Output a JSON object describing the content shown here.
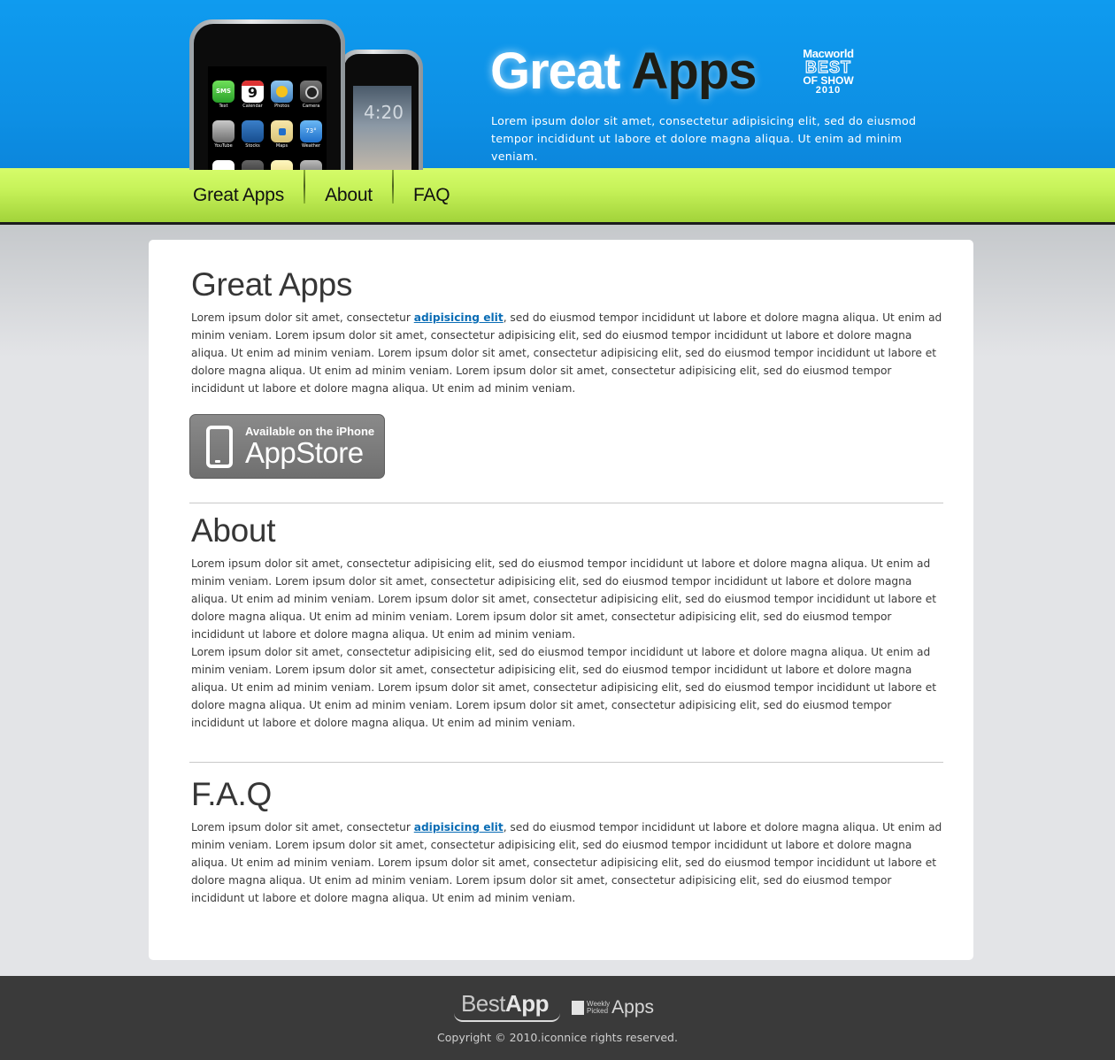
{
  "header": {
    "title_word1": "Great",
    "title_word2": "Apps",
    "tagline": "Lorem ipsum dolor sit amet, consectetur adipisicing elit, sed do eiusmod tempor incididunt ut labore et dolore magna aliqua. Ut enim ad minim veniam.",
    "badge": {
      "line1": "Macworld",
      "line2": "BEST",
      "line3": "OF SHOW",
      "line4": "2010"
    },
    "phone": {
      "apps": [
        {
          "label": "Text",
          "tile_text": "SMS"
        },
        {
          "label": "Calendar",
          "tile_text": "9"
        },
        {
          "label": "Photos",
          "tile_text": ""
        },
        {
          "label": "Camera",
          "tile_text": ""
        },
        {
          "label": "YouTube",
          "tile_text": ""
        },
        {
          "label": "Stocks",
          "tile_text": ""
        },
        {
          "label": "Maps",
          "tile_text": ""
        },
        {
          "label": "Weather",
          "tile_text": "73°"
        }
      ],
      "back_time": "4:20"
    }
  },
  "nav": {
    "items": [
      {
        "label": "Great Apps"
      },
      {
        "label": "About"
      },
      {
        "label": "FAQ"
      }
    ]
  },
  "sections": {
    "great_apps": {
      "heading": "Great Apps",
      "text_before_link": "Lorem ipsum dolor sit amet, consectetur ",
      "link": "adipisicing elit",
      "text_after_link": ", sed do eiusmod tempor incididunt ut labore et dolore magna aliqua. Ut enim ad minim veniam. Lorem ipsum dolor sit amet, consectetur adipisicing elit, sed do eiusmod tempor incididunt ut labore et dolore magna aliqua. Ut enim ad minim veniam. Lorem ipsum dolor sit amet, consectetur adipisicing elit, sed do eiusmod tempor incididunt ut labore et dolore magna aliqua. Ut enim ad minim veniam. Lorem ipsum dolor sit amet, consectetur adipisicing elit, sed do eiusmod tempor incididunt ut labore et dolore magna aliqua. Ut enim ad minim veniam.",
      "appstore": {
        "small": "Available on the iPhone",
        "big": "AppStore"
      }
    },
    "about": {
      "heading": "About",
      "paragraph1": "Lorem ipsum dolor sit amet, consectetur adipisicing elit, sed do eiusmod tempor incididunt ut labore et dolore magna aliqua. Ut enim ad minim veniam. Lorem ipsum dolor sit amet, consectetur adipisicing elit, sed do eiusmod tempor incididunt ut labore et dolore magna aliqua. Ut enim ad minim veniam. Lorem ipsum dolor sit amet, consectetur adipisicing elit, sed do eiusmod tempor incididunt ut labore et dolore magna aliqua. Ut enim ad minim veniam. Lorem ipsum dolor sit amet, consectetur adipisicing elit, sed do eiusmod tempor incididunt ut labore et dolore magna aliqua. Ut enim ad minim veniam.",
      "paragraph2": "Lorem ipsum dolor sit amet, consectetur adipisicing elit, sed do eiusmod tempor incididunt ut labore et dolore magna aliqua. Ut enim ad minim veniam. Lorem ipsum dolor sit amet, consectetur adipisicing elit, sed do eiusmod tempor incididunt ut labore et dolore magna aliqua. Ut enim ad minim veniam. Lorem ipsum dolor sit amet, consectetur adipisicing elit, sed do eiusmod tempor incididunt ut labore et dolore magna aliqua. Ut enim ad minim veniam. Lorem ipsum dolor sit amet, consectetur adipisicing elit, sed do eiusmod tempor incididunt ut labore et dolore magna aliqua. Ut enim ad minim veniam."
    },
    "faq": {
      "heading": "F.A.Q",
      "text_before_link": "Lorem ipsum dolor sit amet, consectetur ",
      "link": "adipisicing elit",
      "text_after_link": ", sed do eiusmod tempor incididunt ut labore et dolore magna aliqua. Ut enim ad minim veniam. Lorem ipsum dolor sit amet, consectetur adipisicing elit, sed do eiusmod tempor incididunt ut labore et dolore magna aliqua. Ut enim ad minim veniam. Lorem ipsum dolor sit amet, consectetur adipisicing elit, sed do eiusmod tempor incididunt ut labore et dolore magna aliqua. Ut enim ad minim veniam. Lorem ipsum dolor sit amet, consectetur adipisicing elit, sed do eiusmod tempor incididunt ut labore et dolore magna aliqua. Ut enim ad minim veniam."
    }
  },
  "footer": {
    "logo1_light": "Best",
    "logo1_bold": "App",
    "logo2_small1": "Weekly",
    "logo2_small2": "Picked",
    "logo2_big": "Apps",
    "copyright": "Copyright © 2010.iconnice rights reserved."
  },
  "colors": {
    "header_blue": "#0f9bef",
    "nav_green": "#c6f259",
    "link_blue": "#0a6db5",
    "footer_bg": "#3a3a3a",
    "page_bg": "#e3e4e7"
  },
  "icons": [
    "iphone-image",
    "app-store-badge",
    "iphone-icon"
  ]
}
